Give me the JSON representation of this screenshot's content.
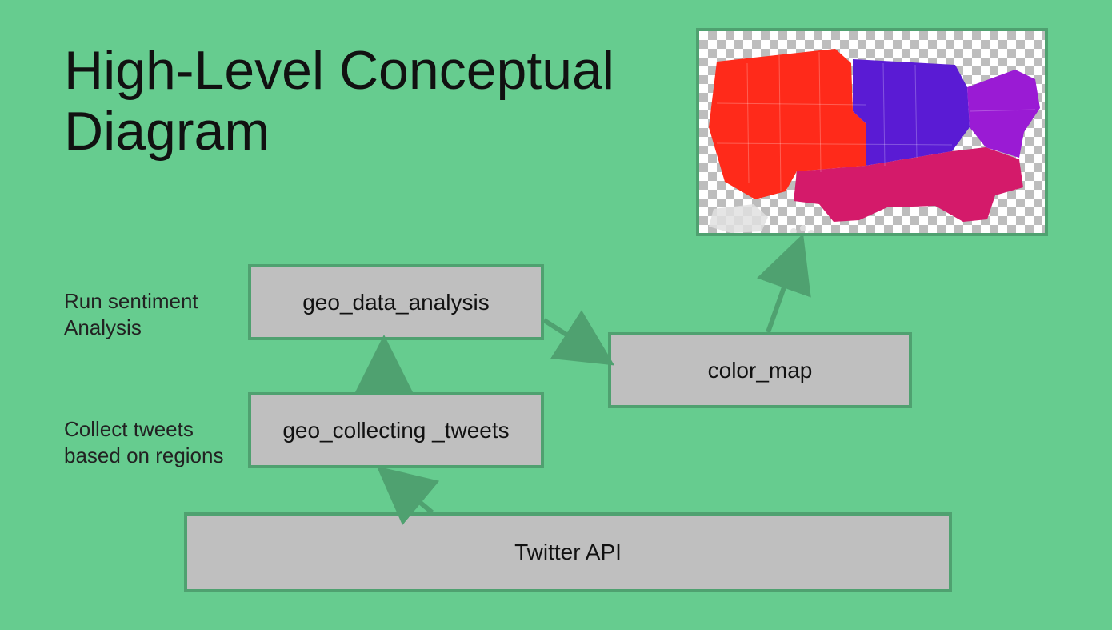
{
  "title_line1": "High-Level Conceptual",
  "title_line2": "Diagram",
  "captions": {
    "sentiment": "Run sentiment\nAnalysis",
    "collect": "Collect tweets\nbased on regions"
  },
  "nodes": {
    "twitter_api": "Twitter API",
    "geo_collect": "geo_collecting _tweets",
    "geo_analysis": "geo_data_analysis",
    "color_map": "color_map"
  },
  "map": {
    "regions": {
      "west": "#ff2a1a",
      "midwest": "#5a1bd4",
      "south": "#d41a6a",
      "northeast": "#9a1bd4"
    },
    "noncontiguous": "#e0e0e0"
  },
  "edges": [
    "twitter_api -> geo_collect",
    "geo_collect -> geo_analysis",
    "geo_analysis -> color_map",
    "color_map -> output_map"
  ]
}
